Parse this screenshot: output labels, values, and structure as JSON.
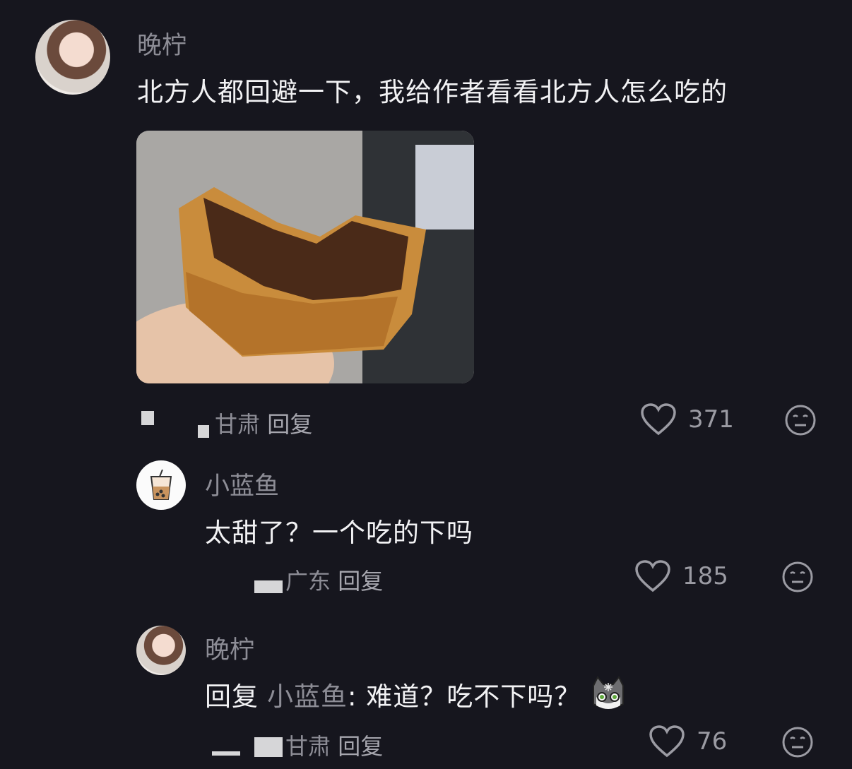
{
  "comment": {
    "author": "晚柠",
    "text": "北方人都回避一下，我给作者看看北方人怎么吃的",
    "location": "甘肃",
    "reply_label": "回复",
    "likes": "371"
  },
  "replies": [
    {
      "author": "小蓝鱼",
      "text": "太甜了？一个吃的下吗",
      "location": "广东",
      "reply_label": "回复",
      "likes": "185"
    },
    {
      "author": "晚柠",
      "reply_prefix": "回复",
      "reply_to": "小蓝鱼",
      "text": ": 难道？吃不下吗？",
      "location": "甘肃",
      "reply_label": "回复",
      "likes": "76"
    }
  ],
  "icons": {
    "like": "heart-outline-icon",
    "react": "neutral-face-icon",
    "emoji": "cat-face-emoji"
  }
}
